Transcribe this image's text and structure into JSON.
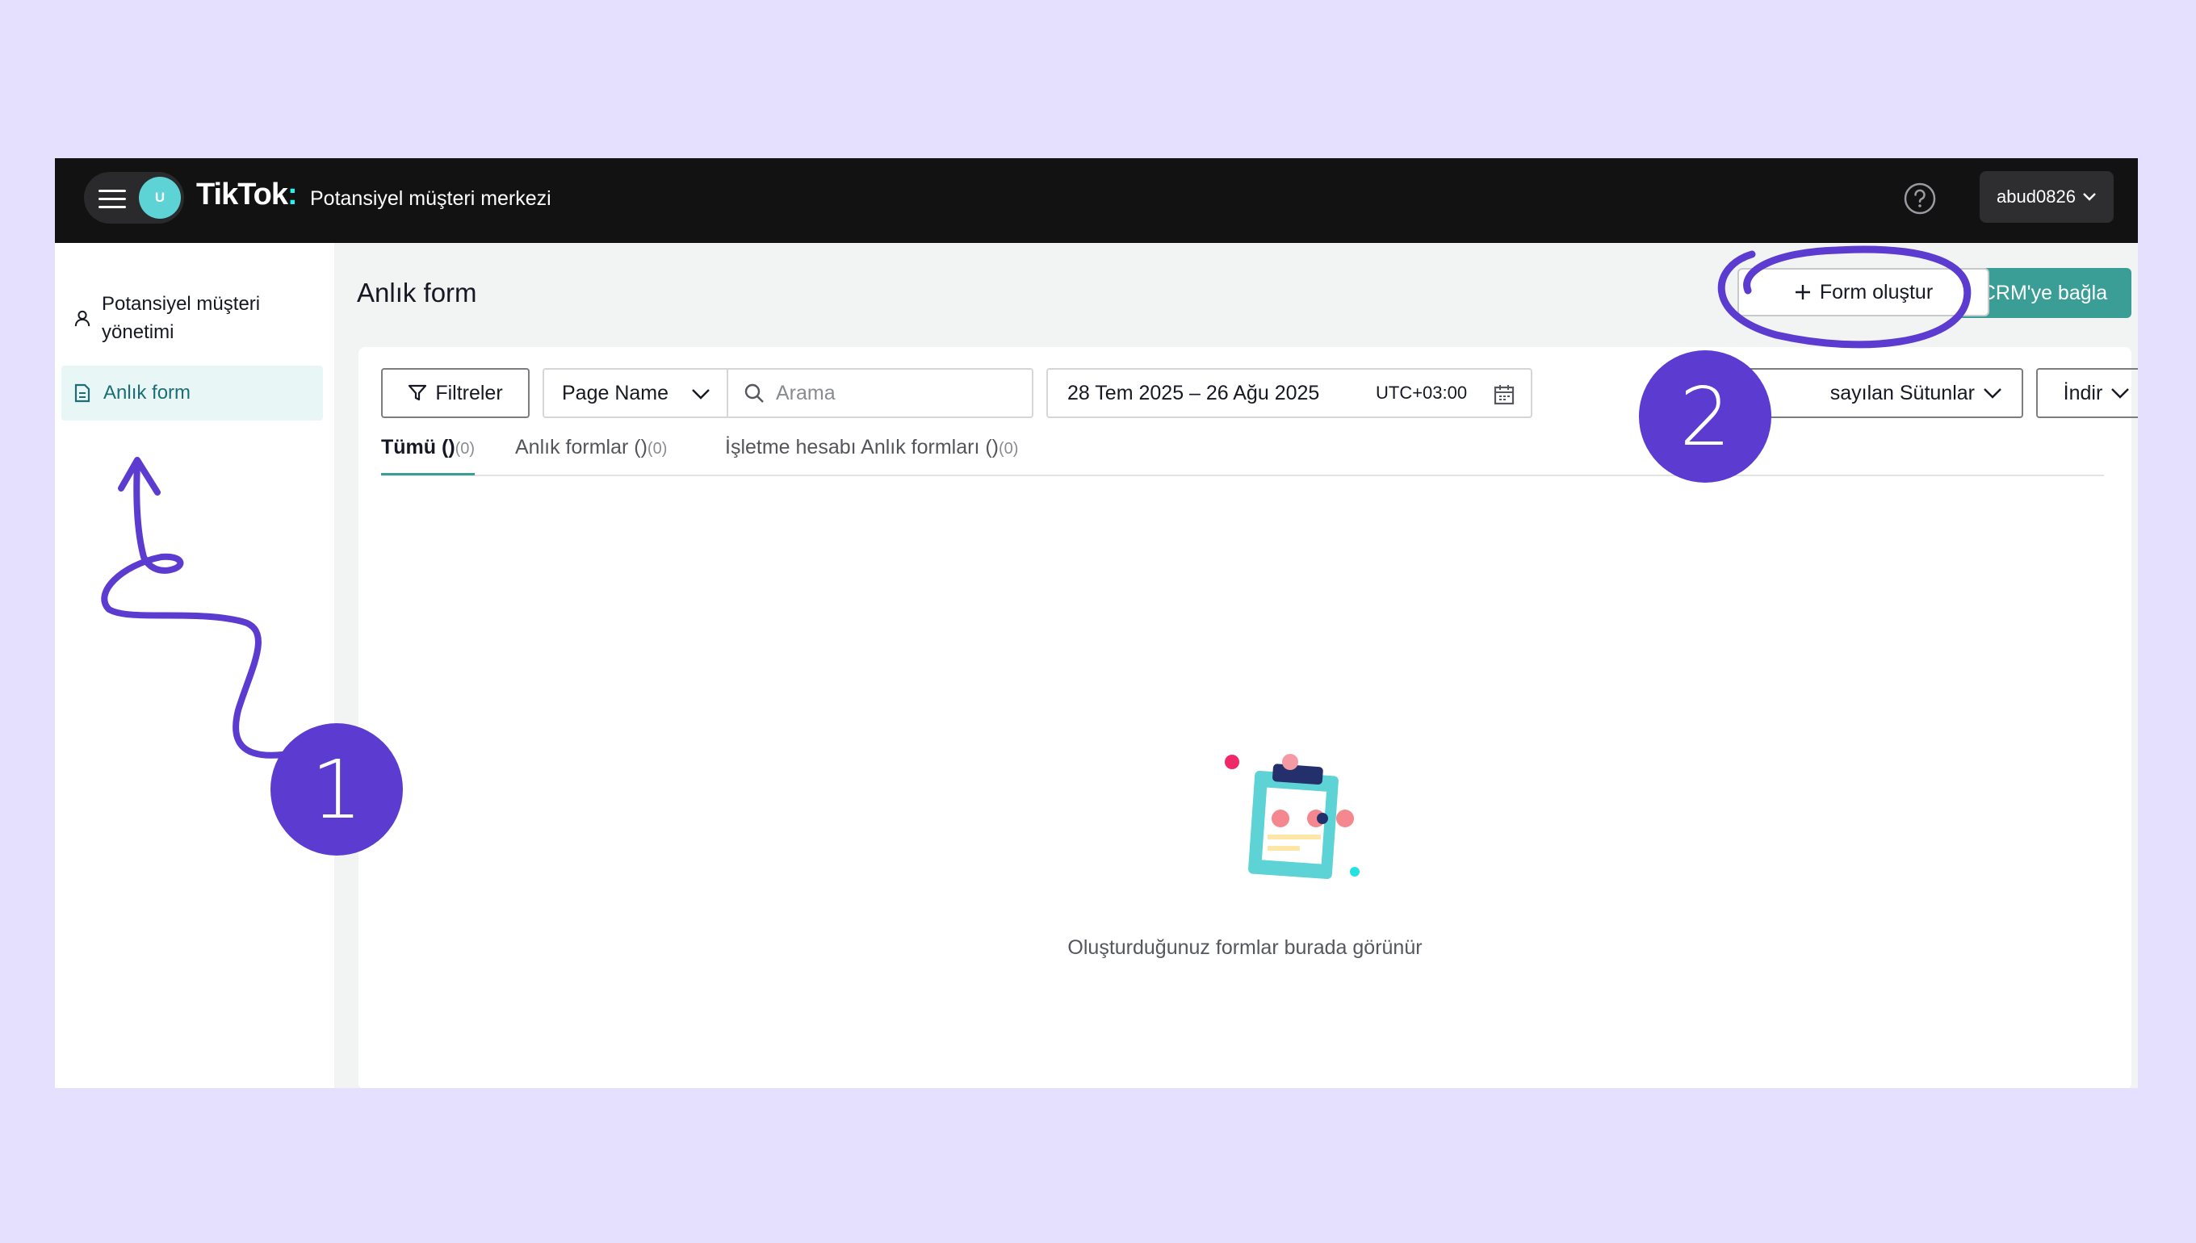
{
  "topbar": {
    "avatar_letter": "U",
    "logo_text": "TikTok",
    "logo_colon": ":",
    "app_title": "Potansiyel müşteri merkezi",
    "username": "abud0826"
  },
  "sidebar": {
    "items": [
      {
        "label": "Potansiyel müşteri yönetimi"
      },
      {
        "label": "Anlık form"
      }
    ]
  },
  "header": {
    "title": "Anlık form",
    "create_form_label": "Form oluştur",
    "connect_crm_label": "CRM'ye bağla"
  },
  "toolbar": {
    "filters_label": "Filtreler",
    "page_select_value": "Page Name",
    "search_placeholder": "Arama",
    "date_range": "28 Tem 2025 – 26 Ağu 2025",
    "timezone": "UTC+03:00",
    "columns_label": "sayılan Sütunlar",
    "download_label": "İndir"
  },
  "tabs": [
    {
      "label": "Tümü ()",
      "count": "(0)"
    },
    {
      "label": "Anlık formlar ()",
      "count": "(0)"
    },
    {
      "label": "İşletme hesabı Anlık formları ()",
      "count": "(0)"
    }
  ],
  "empty_state": {
    "message": "Oluşturduğunuz formlar burada görünür"
  },
  "annotations": {
    "badge_1": "1",
    "badge_2": "2",
    "color": "#5b3bd0"
  },
  "colors": {
    "accent": "#3b9e96",
    "topbar": "#121212",
    "background": "#e4e0fd"
  }
}
